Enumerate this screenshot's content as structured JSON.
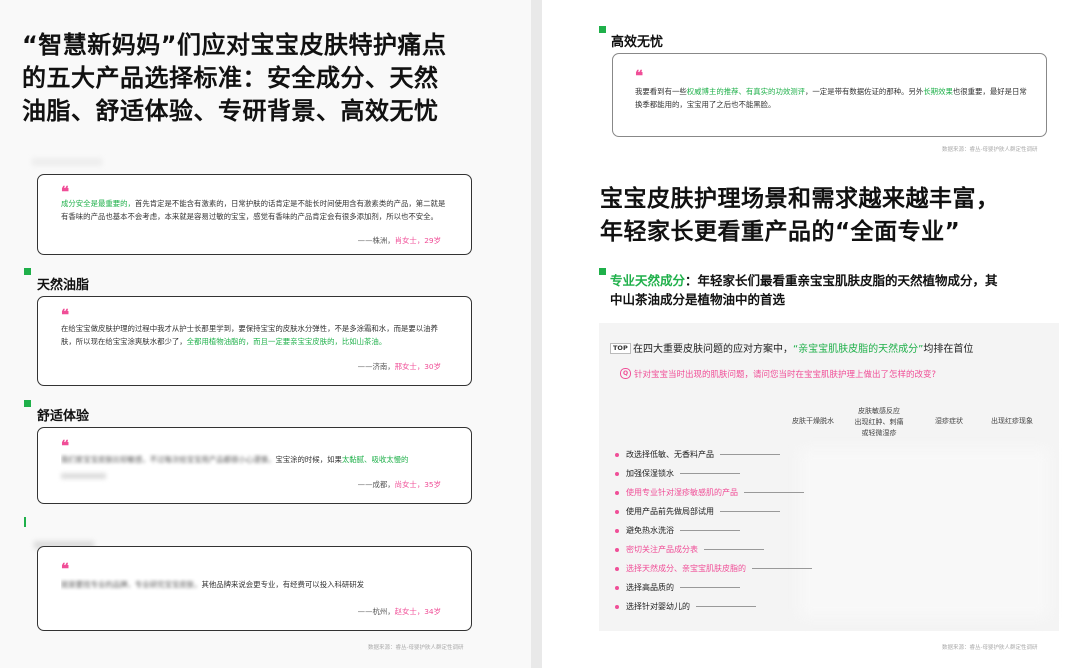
{
  "left": {
    "title_lines": [
      "“智慧新妈妈”们应对宝宝皮肤特护痛点",
      "的五大产品选择标准：安全成分、天然",
      "油脂、舒适体验、专研背景、高效无忧"
    ],
    "quote1": {
      "hl": "成分安全是最重要的，",
      "text": "首先肯定是不能含有激素的，日常护肤的话肯定是不能长时间使用含有激素类的产品，第二就是有香味的产品也基本不会考虑，本来就是容易过敏的宝宝，感觉有香味的产品肯定会有很多添加剂，所以也不安全。",
      "city": "——株洲，",
      "person": "肖女士，29岁"
    },
    "section2": "天然油脂",
    "quote2": {
      "text": "在给宝宝做皮肤护理的过程中我才从护士长那里学到，要保持宝宝的皮肤水分弹性，不是多涂霜和水，而是要以油养肤，所以现在给宝宝涂爽肤水都少了，",
      "hl": "全都用植物油脂的，而且一定要亲宝宝皮肤的，比如山茶油。",
      "city": "——济南，",
      "person": "邢女士，30岁"
    },
    "section3": "舒适体验",
    "quote3": {
      "blurred": "我们家宝宝皮肤比较敏感，不过每次给宝宝用产品都很小心谨慎，",
      "text": "宝宝涂的时候，如果",
      "hl": "太黏腻、吸收太慢的",
      "city": "——成都，",
      "person": "尚女士，35岁"
    },
    "quote4": {
      "blurred": "就是要找专业的品牌，专业研究宝宝皮肤，",
      "text": "其他品牌来说会更专业，有经费可以投入科研研发",
      "city": "——杭州，",
      "person": "赵女士，34岁"
    },
    "source": "数据来源：睿丛-母婴护肤人群定性调研"
  },
  "right": {
    "section_top": "高效无忧",
    "quote5": {
      "t1": "我要看到有一些",
      "hl1": "权威博主的推荐、有真实的功效测评",
      "t2": "，一定是带有数据佐证的那种。另外",
      "hl2": "长期效果",
      "t3": "也很重要，最好是日常换季都能用的，宝宝用了之后也不能黑脸。"
    },
    "source1": "数据来源：睿丛-母婴护肤人群定性调研",
    "title_lines": [
      "宝宝皮肤护理场景和需求越来越丰富，",
      "年轻家长更看重产品的“全面专业”"
    ],
    "sub_hl": "专业天然成分",
    "sub_text1": "：年轻家长们最看重亲宝宝肌肤皮脂的天然植物成分，其",
    "sub_text2": "中山茶油成分是植物油中的首选",
    "panel": {
      "top_badge": "TOP",
      "head1": "在四大重要皮肤问题的应对方案中，",
      "head_hl": "“亲宝宝肌肤皮脂的天然成分”",
      "head2": "均排在首位",
      "question_icon": "Q",
      "question": "针对宝宝当时出现的肌肤问题，请问您当时在宝宝肌肤护理上做出了怎样的改变?",
      "columns": [
        "皮肤干燥脱水",
        "皮肤敏感反应\n出现红肿、刺痛\n或轻微湿疹",
        "湿疹症状",
        "出现红疹现象"
      ],
      "items": [
        {
          "label": "改选择低敏、无香料产品",
          "pink": false
        },
        {
          "label": "加强保湿锁水",
          "pink": false
        },
        {
          "label": "使用专业针对湿疹敏感肌的产品",
          "pink": true
        },
        {
          "label": "使用产品前先做局部试用",
          "pink": false
        },
        {
          "label": "避免热水洗浴",
          "pink": false
        },
        {
          "label": "密切关注产品成分表",
          "pink": true
        },
        {
          "label": "选择天然成分、亲宝宝肌肤皮脂的",
          "pink": true
        },
        {
          "label": "选择高品质的",
          "pink": false
        },
        {
          "label": "选择针对婴幼儿的",
          "pink": false
        }
      ]
    },
    "source2": "数据来源：睿丛-母婴护肤人群定性调研"
  },
  "colors": {
    "green": "#1fb04a",
    "pink": "#f04e97"
  }
}
